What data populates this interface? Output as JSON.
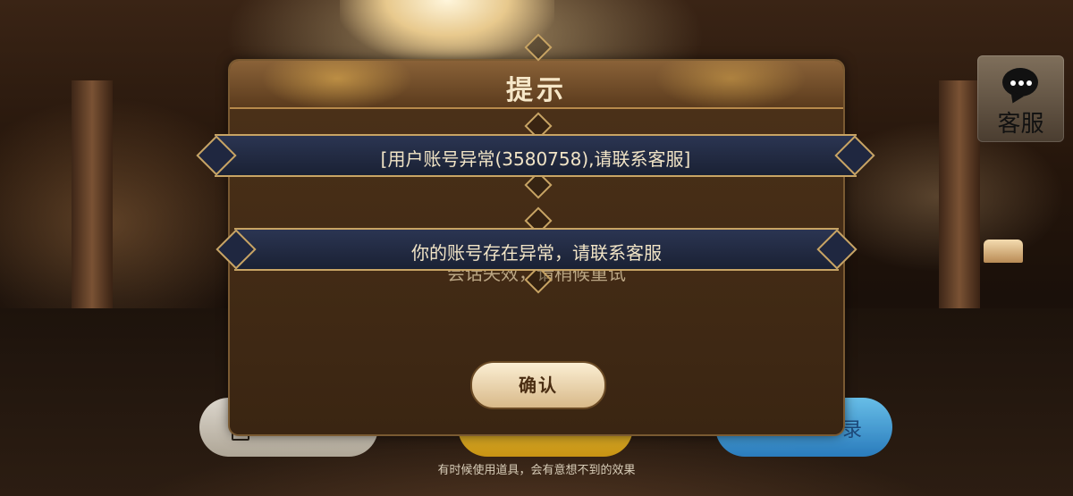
{
  "dialog": {
    "title": "提示",
    "ghost_message": "会话失效，请稍候重试",
    "confirm_label": "确认"
  },
  "banners": [
    {
      "text": "[用户账号异常(3580758),请联系客服]"
    },
    {
      "text": "你的账号存在异常，请联系客服"
    }
  ],
  "customer_service": {
    "label": "客服",
    "icon": "chat-bubble-icon"
  },
  "footer": {
    "hint": "有时候使用道具，会有意想不到的效果"
  },
  "background_buttons": {
    "right_label": "录"
  },
  "colors": {
    "accent_gold": "#c8a464",
    "banner_blue": "#2b3552",
    "dialog_brown": "#3f2814"
  }
}
